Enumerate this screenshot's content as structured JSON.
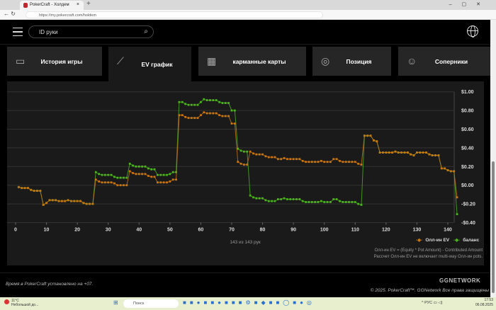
{
  "browser": {
    "tab_title": "PokerCraft - Холдем",
    "url": "https://my.pokercraft.com/holdem"
  },
  "header": {
    "search_placeholder": "ID руки"
  },
  "tabs": [
    {
      "label": "История игры",
      "icon": "clapperboard-icon"
    },
    {
      "label": "EV график",
      "icon": "line-chart-icon",
      "active": true
    },
    {
      "label": "карманные карты",
      "icon": "grid-icon"
    },
    {
      "label": "Позиция",
      "icon": "table-position-icon"
    },
    {
      "label": "Соперники",
      "icon": "devil-face-icon"
    }
  ],
  "chart_data": {
    "type": "line",
    "x_ticks": [
      "0",
      "10",
      "20",
      "30",
      "40",
      "50",
      "60",
      "70",
      "80",
      "90",
      "100",
      "110",
      "120",
      "130",
      "140"
    ],
    "y_ticks": [
      "$1.00",
      "$0.80",
      "$0.60",
      "$0.40",
      "$0.20",
      "$0.00",
      "-$0.20",
      "-$0.40"
    ],
    "xlim": [
      0,
      143
    ],
    "ylim": [
      -0.4,
      1.0
    ],
    "grid": true,
    "legend": "bottom-right",
    "series": [
      {
        "name": "Олл-ин EV",
        "color": "#c8750f",
        "values": [
          -0.02,
          -0.03,
          -0.03,
          -0.03,
          -0.05,
          -0.06,
          -0.06,
          -0.06,
          -0.21,
          -0.19,
          -0.16,
          -0.16,
          -0.16,
          -0.17,
          -0.17,
          -0.17,
          -0.16,
          -0.17,
          -0.17,
          -0.17,
          -0.17,
          -0.19,
          -0.2,
          -0.2,
          -0.2,
          0.06,
          0.04,
          0.03,
          0.03,
          0.03,
          0.03,
          0.02,
          0.0,
          0.0,
          0.0,
          0.0,
          0.15,
          0.13,
          0.12,
          0.12,
          0.12,
          0.12,
          0.1,
          0.09,
          0.09,
          0.03,
          0.03,
          0.03,
          0.03,
          0.04,
          0.06,
          0.06,
          0.75,
          0.75,
          0.73,
          0.72,
          0.72,
          0.72,
          0.72,
          0.75,
          0.78,
          0.77,
          0.77,
          0.77,
          0.77,
          0.75,
          0.74,
          0.74,
          0.74,
          0.66,
          0.66,
          0.25,
          0.23,
          0.22,
          0.22,
          0.36,
          0.34,
          0.33,
          0.33,
          0.33,
          0.31,
          0.3,
          0.3,
          0.3,
          0.28,
          0.28,
          0.29,
          0.28,
          0.28,
          0.28,
          0.28,
          0.28,
          0.26,
          0.25,
          0.25,
          0.25,
          0.25,
          0.25,
          0.26,
          0.25,
          0.25,
          0.25,
          0.28,
          0.28,
          0.26,
          0.25,
          0.25,
          0.25,
          0.25,
          0.25,
          0.23,
          0.22,
          0.53,
          0.53,
          0.53,
          0.48,
          0.47,
          0.35,
          0.35,
          0.35,
          0.35,
          0.35,
          0.36,
          0.35,
          0.35,
          0.35,
          0.35,
          0.33,
          0.32,
          0.35,
          0.35,
          0.35,
          0.35,
          0.33,
          0.32,
          0.32,
          0.32,
          0.18,
          0.18,
          0.16,
          0.15,
          0.15,
          -0.13
        ]
      },
      {
        "name": "баланс",
        "color": "#4cb31c",
        "values": [
          -0.02,
          -0.03,
          -0.03,
          -0.03,
          -0.05,
          -0.06,
          -0.06,
          -0.06,
          -0.21,
          -0.19,
          -0.16,
          -0.16,
          -0.16,
          -0.17,
          -0.17,
          -0.17,
          -0.16,
          -0.17,
          -0.17,
          -0.17,
          -0.17,
          -0.19,
          -0.2,
          -0.2,
          -0.2,
          0.14,
          0.12,
          0.11,
          0.11,
          0.11,
          0.11,
          0.09,
          0.08,
          0.08,
          0.08,
          0.08,
          0.23,
          0.21,
          0.2,
          0.2,
          0.2,
          0.2,
          0.18,
          0.17,
          0.17,
          0.11,
          0.11,
          0.11,
          0.11,
          0.12,
          0.14,
          0.14,
          0.89,
          0.89,
          0.87,
          0.86,
          0.86,
          0.86,
          0.86,
          0.89,
          0.92,
          0.91,
          0.91,
          0.91,
          0.91,
          0.89,
          0.88,
          0.88,
          0.88,
          0.8,
          0.8,
          0.39,
          0.37,
          0.36,
          0.36,
          -0.11,
          -0.13,
          -0.14,
          -0.14,
          -0.14,
          -0.16,
          -0.17,
          -0.17,
          -0.17,
          -0.15,
          -0.15,
          -0.14,
          -0.15,
          -0.15,
          -0.15,
          -0.15,
          -0.15,
          -0.17,
          -0.18,
          -0.18,
          -0.18,
          -0.18,
          -0.18,
          -0.17,
          -0.18,
          -0.18,
          -0.18,
          -0.15,
          -0.15,
          -0.17,
          -0.18,
          -0.18,
          -0.18,
          -0.18,
          -0.18,
          -0.2,
          -0.21,
          0.53,
          0.53,
          0.53,
          0.48,
          0.47,
          0.35,
          0.35,
          0.35,
          0.35,
          0.35,
          0.36,
          0.35,
          0.35,
          0.35,
          0.35,
          0.33,
          0.32,
          0.35,
          0.35,
          0.35,
          0.35,
          0.33,
          0.32,
          0.32,
          0.32,
          0.18,
          0.18,
          0.16,
          0.15,
          0.15,
          -0.31
        ]
      }
    ]
  },
  "hand_count": "143 из 143 рук",
  "legend": {
    "ev": "Олл-ин EV",
    "balance": "баланс"
  },
  "notes": [
    "Олл-ин EV = (Equity * Pot Amount) - Contributed Amount",
    "Рассчет Олл-ин EV не включает multi-way Олл-ин pots."
  ],
  "footer": {
    "timezone": "Время в PokerCraft установлено на +07.",
    "logo": "GGNETWORK",
    "copyright": "© 2025. PokerCraft™. GGNetwork Все права защищены"
  },
  "taskbar": {
    "weather_temp": "11°C",
    "weather_text": "Небольшой до...",
    "search": "Поиск",
    "lang": "РУС",
    "time": "17:53",
    "date": "06.08.2025"
  }
}
